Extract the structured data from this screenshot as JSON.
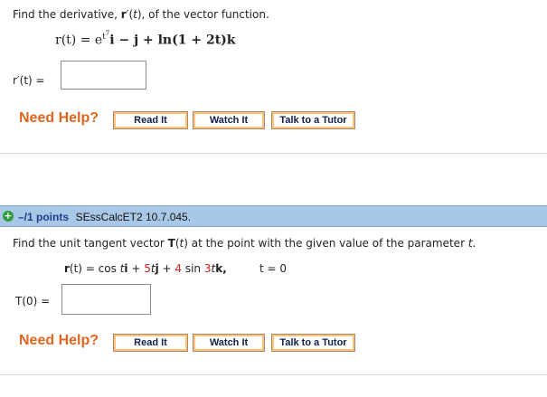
{
  "q1": {
    "prompt_pre": "Find the derivative, ",
    "prompt_func": "r",
    "prompt_mid": "′(",
    "prompt_var": "t",
    "prompt_post": "), of the vector function.",
    "formula": {
      "lhs": "r(t) = e",
      "exp": "t",
      "exp2": "7",
      "rest": "i − j + ln(1 + 2t)k"
    },
    "answer_label": "r′(t)  =",
    "answer_value": ""
  },
  "help1": {
    "label": "Need Help?",
    "read": "Read It",
    "watch": "Watch It",
    "tutor": "Talk to a Tutor"
  },
  "q2_header": {
    "plus": "+",
    "points": "–/1 points",
    "id": "SEssCalcET2 10.7.045."
  },
  "q2": {
    "prompt_pre": "Find the unit tangent vector ",
    "prompt_T": "T",
    "prompt_mid": "(",
    "prompt_t": "t",
    "prompt_post": ") at the point with the given value of the parameter ",
    "prompt_end": ".",
    "eq_r": "r",
    "eq_a": "(t)  =  cos ",
    "eq_t1": "t",
    "eq_i": "i",
    "eq_plus1": "  +  ",
    "eq_five": "5",
    "eq_t2": "t",
    "eq_j": "j",
    "eq_plus2": "  +  ",
    "eq_four": "4",
    "eq_sin": " sin ",
    "eq_three": "3",
    "eq_t3": "t",
    "eq_k": "k",
    "eq_comma": ",",
    "param": "t  =  0",
    "answer_label": "T(0)  =",
    "answer_value": ""
  },
  "help2": {
    "label": "Need Help?",
    "read": "Read It",
    "watch": "Watch It",
    "tutor": "Talk to a Tutor"
  },
  "colors": {
    "help_orange": "#e0651f",
    "button_border": "#fbc37a",
    "header_blue": "#a9c7e6",
    "points_blue": "#1b3f8b",
    "coeff_red": "#d21f1f"
  }
}
